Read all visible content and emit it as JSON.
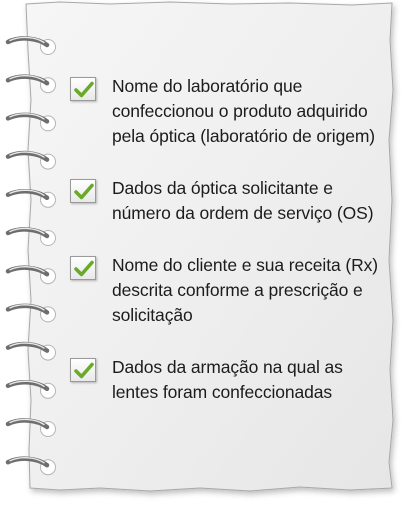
{
  "checklist": {
    "items": [
      {
        "text": "Nome do laboratório que confeccionou o produto adquirido pela óptica (laboratório de origem)",
        "checked": true
      },
      {
        "text": "Dados da óptica solicitante e número da ordem de serviço (OS)",
        "checked": true
      },
      {
        "text": "Nome do cliente e sua receita (Rx) descrita conforme a prescrição e solicitação",
        "checked": true
      },
      {
        "text": "Dados da armação na qual as lentes foram confeccionadas",
        "checked": true
      }
    ]
  },
  "colors": {
    "paper": "#f3f3f3",
    "paper_edge": "#9a9a9a",
    "check": "#6aaa2a",
    "text": "#1c1c1c"
  },
  "icons": {
    "check": "checkmark-icon",
    "ring": "spiral-ring-icon",
    "hole": "punch-hole-icon"
  }
}
